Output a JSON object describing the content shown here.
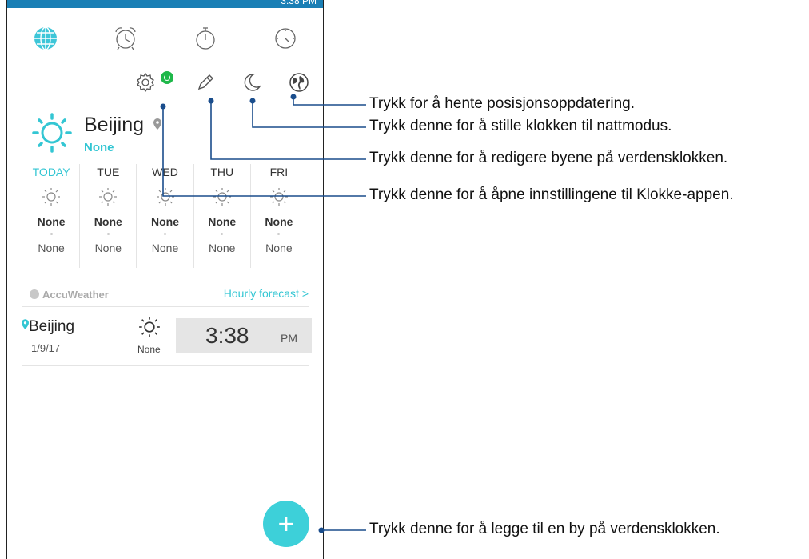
{
  "status": {
    "time": "3:38 PM"
  },
  "tabs": [
    {
      "id": "world-clock",
      "icon": "globe-icon"
    },
    {
      "id": "alarm",
      "icon": "alarm-clock-icon"
    },
    {
      "id": "stopwatch",
      "icon": "stopwatch-icon"
    },
    {
      "id": "timer",
      "icon": "timer-icon"
    }
  ],
  "toolbar": {
    "settings_icon": "gear-icon",
    "edit_icon": "pencil-icon",
    "night_icon": "moon-icon",
    "location_icon": "globe-location-icon"
  },
  "weather": {
    "city": "Beijing",
    "condition": "None",
    "forecast": [
      {
        "day": "TODAY",
        "high": "None",
        "low": "None"
      },
      {
        "day": "TUE",
        "high": "None",
        "low": "None"
      },
      {
        "day": "WED",
        "high": "None",
        "low": "None"
      },
      {
        "day": "THU",
        "high": "None",
        "low": "None"
      },
      {
        "day": "FRI",
        "high": "None",
        "low": "None"
      }
    ],
    "provider": "AccuWeather",
    "hourly_link": "Hourly forecast >"
  },
  "world_clock": {
    "city": "Beijing",
    "date": "1/9/17",
    "condition": "None",
    "time": "3:38",
    "ampm": "PM"
  },
  "callouts": {
    "location": "Trykk for å hente posisjonsoppdatering.",
    "night": "Trykk denne for å stille klokken til nattmodus.",
    "edit": "Trykk denne for å redigere byene på verdensklokken.",
    "settings": "Trykk denne for å åpne innstillingene til Klokke-appen.",
    "add": "Trykk denne for å legge til en by på verdensklokken."
  },
  "colors": {
    "accent": "#33c6d3",
    "fab": "#3dd0d9",
    "badge": "#1fb84a"
  }
}
